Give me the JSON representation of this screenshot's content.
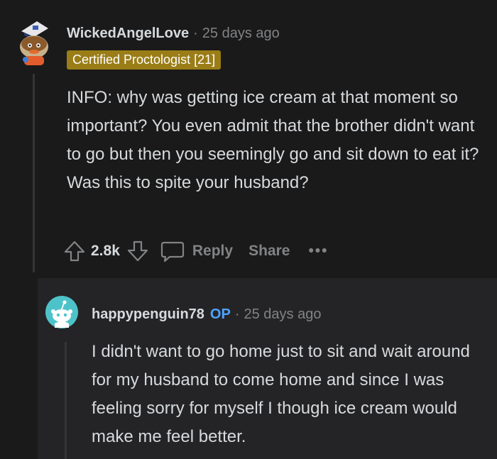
{
  "top_comment": {
    "author": "WickedAngelLove",
    "separator": "·",
    "timestamp": "25 days ago",
    "flair": "Certified Proctologist [21]",
    "body": "INFO: why was getting ice cream at that moment so important? You even admit that the brother didn't want to go but then you seemingly go and sit down to eat it? Was this to spite your husband?",
    "votes": "2.8k",
    "reply_label": "Reply",
    "share_label": "Share",
    "more_label": "•••",
    "avatar_icon": "snoo-avatar-icon"
  },
  "reply_comment": {
    "author": "happypenguin78",
    "op_badge": "OP",
    "separator": "·",
    "timestamp": "25 days ago",
    "body": "I didn't want to go home just to sit and wait around for my husband to come home and since I was feeling sorry for myself I though ice cream would make me feel better.",
    "avatar_icon": "default-snoo-avatar-icon"
  },
  "colors": {
    "background": "#1a1a1b",
    "reply_background": "#242426",
    "flair_background": "#9a7d17",
    "op_color": "#4fa3ff",
    "muted_text": "#818384",
    "text": "#d7dadc"
  }
}
